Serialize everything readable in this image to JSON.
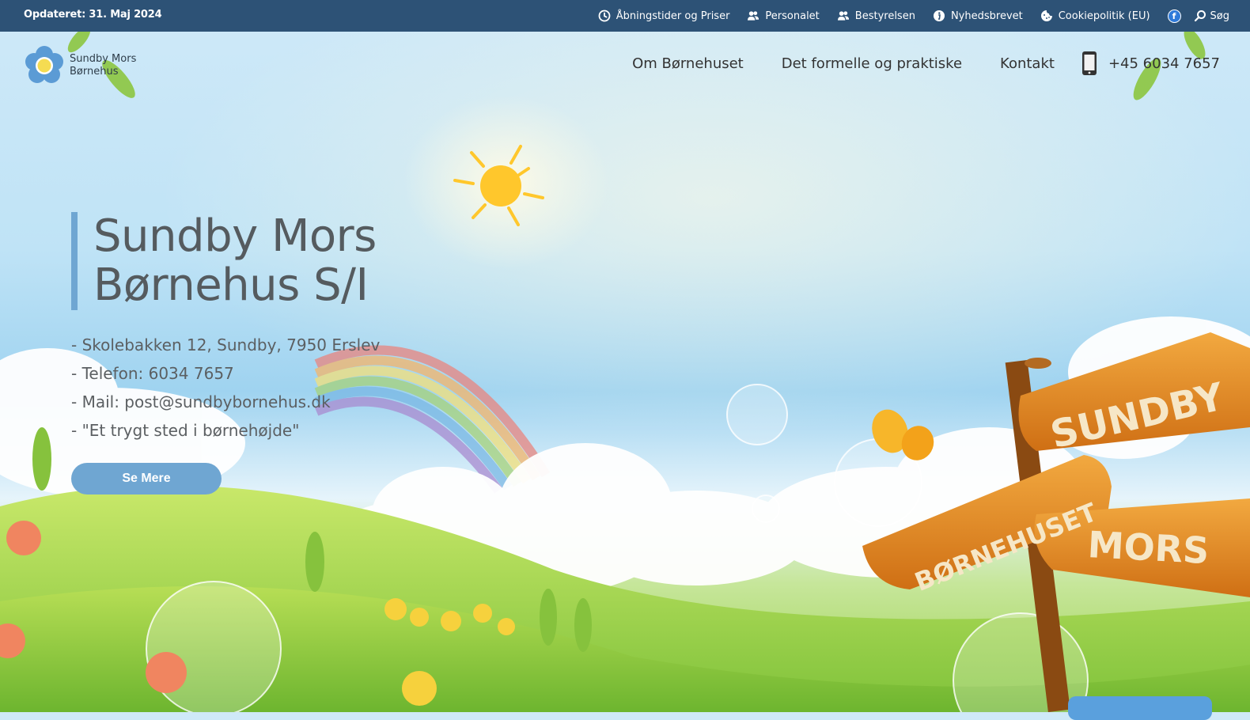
{
  "topbar": {
    "updated": "Opdateret: 31. Maj 2024",
    "links": [
      {
        "label": "Åbningstider og Priser",
        "icon": "clock-icon"
      },
      {
        "label": "Personalet",
        "icon": "users-icon"
      },
      {
        "label": "Bestyrelsen",
        "icon": "users-icon"
      },
      {
        "label": "Nyhedsbrevet",
        "icon": "info-icon"
      },
      {
        "label": "Cookiepolitik (EU)",
        "icon": "cookie-icon"
      }
    ],
    "facebook_icon": "facebook-icon",
    "search_label": "Søg"
  },
  "header": {
    "logo_line1": "Sundby Mors",
    "logo_line2": "Børnehus",
    "nav": [
      "Om Børnehuset",
      "Det formelle og praktiske",
      "Kontakt"
    ],
    "phone": "+45 6034 7657",
    "phone_icon": "phone-icon"
  },
  "hero": {
    "title_line1": "Sundby Mors",
    "title_line2": "Børnehus S/I",
    "details": [
      "- Skolebakken 12, Sundby, 7950 Erslev",
      "- Telefon: 6034 7657",
      "- Mail: post@sundbybornehus.dk",
      "- \"Et trygt sted i børnehøjde\""
    ],
    "cta_label": "Se Mere"
  },
  "sign": {
    "top": "SUNDBY",
    "middle": "BØRNEHUSET",
    "bottom": "MORS"
  },
  "colors": {
    "topbar": "#2d5276",
    "accent": "#6fa6d2",
    "sign": "#e08a22"
  }
}
